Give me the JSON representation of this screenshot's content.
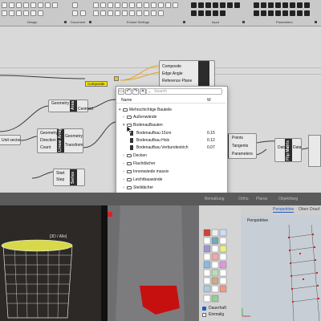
{
  "ribbon": {
    "groups": [
      {
        "label": "Design",
        "drop": "true"
      },
      {
        "label": "Document",
        "drop": "true"
      },
      {
        "label": "Extract Settings",
        "drop": "true"
      },
      {
        "label": "Input",
        "drop": "true"
      },
      {
        "label": "Parameters",
        "drop": "true"
      }
    ]
  },
  "canvas": {
    "composite_param": "Composite",
    "top_component": {
      "inputs": [
        "Composite",
        "Edge Angle",
        "Reference Plane"
      ]
    },
    "area": {
      "inputs": [
        "Geometry"
      ],
      "outputs": [
        "Centroid"
      ],
      "core": "Area"
    },
    "unitvector": {
      "label": "Unit vector"
    },
    "linear_array": {
      "inputs": [
        "Geometry",
        "Direction",
        "Count"
      ],
      "outputs": [
        "Geometry",
        "Transform"
      ],
      "core": "Linear Array"
    },
    "series": {
      "inputs": [
        "Start",
        "Step"
      ],
      "core": "Series"
    },
    "right_component": {
      "inputs": [
        "Points",
        "Tangents",
        "Parameters"
      ]
    },
    "flip": {
      "ports": [
        "Data",
        "Data"
      ],
      "core": "Flip Matrix"
    }
  },
  "popup": {
    "toolbar_icons": [
      "stamp-icon",
      "undo-icon",
      "redo-icon",
      "delete-icon"
    ],
    "search_placeholder": "Search",
    "columns": {
      "name": "Name",
      "w": "W"
    },
    "root": "Mehrschichtige Bauteile",
    "items": [
      {
        "label": "Außenwände",
        "level": 1,
        "type": "folder",
        "expanded": "false"
      },
      {
        "label": "Bodenaufbauten",
        "level": 1,
        "type": "folder",
        "expanded": "true"
      },
      {
        "label": "Bodenaufbau 15cm",
        "level": 2,
        "type": "item",
        "value": "0.15"
      },
      {
        "label": "Bodenaufbau Holz",
        "level": 2,
        "type": "item",
        "value": "0.12"
      },
      {
        "label": "Bodenaufbau Verbundestrich",
        "level": 2,
        "type": "item",
        "value": "0.07"
      },
      {
        "label": "Decken",
        "level": 1,
        "type": "folder",
        "expanded": "false"
      },
      {
        "label": "Flachdächer",
        "level": 1,
        "type": "folder",
        "expanded": "false"
      },
      {
        "label": "Innenwände massiv",
        "level": 1,
        "type": "folder",
        "expanded": "false"
      },
      {
        "label": "Leichtbauwände",
        "level": 1,
        "type": "folder",
        "expanded": "false"
      },
      {
        "label": "Steildächer",
        "level": 1,
        "type": "folder",
        "expanded": "false"
      }
    ]
  },
  "tabs": [
    "Bemaßung",
    "Ortho",
    "Planar",
    "Objektfang"
  ],
  "viewports": {
    "vp1_title": "[3D / Alle]",
    "vp4_tabs": [
      "Perspektive",
      "Oben",
      "Drauf"
    ],
    "vp4_active": "Perspektive",
    "vp4_title": "Perspektive"
  },
  "toolpanel": {
    "checkboxes": [
      "Dauerhaft",
      "Einmalig"
    ]
  },
  "colors": {
    "param_yellow": "#f5e600",
    "component_dark": "#2c2c2c",
    "accent_blue": "#1d5cc7"
  }
}
